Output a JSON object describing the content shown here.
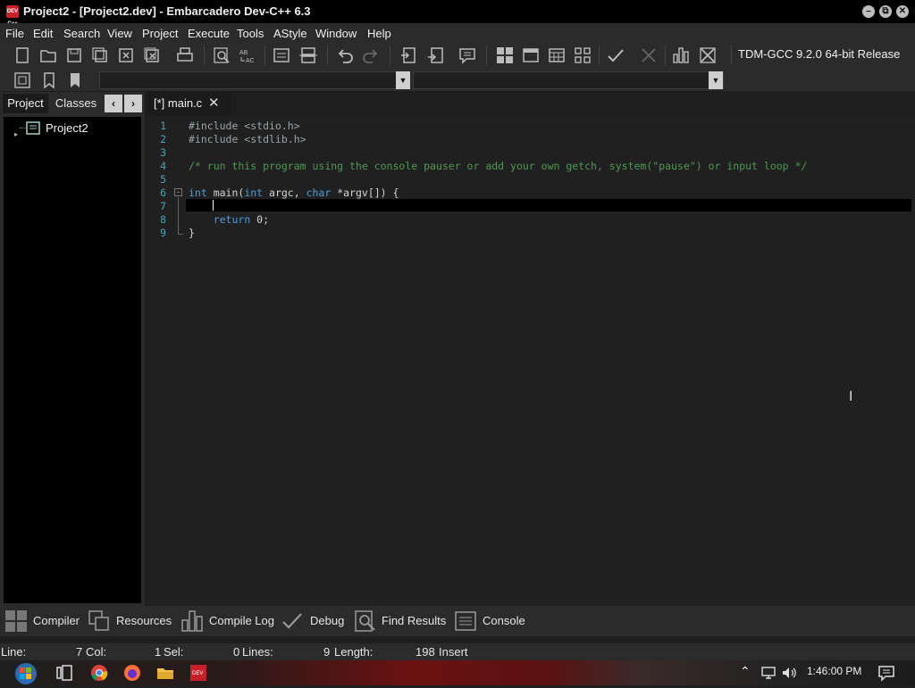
{
  "window": {
    "app_icon_text": "DEV C++",
    "title": "Project2 - [Project2.dev] - Embarcadero Dev-C++ 6.3",
    "minimize": "–",
    "restore": "⧉",
    "close": "✕"
  },
  "menu": [
    "File",
    "Edit",
    "Search",
    "View",
    "Project",
    "Execute",
    "Tools",
    "AStyle",
    "Window",
    "Help"
  ],
  "toolbar": {
    "compiler": "TDM-GCC 9.2.0 64-bit Release",
    "icons": [
      "new-file-icon",
      "open-icon",
      "save-icon",
      "save-all-icon",
      "close-icon",
      "close-all-icon",
      "print-icon",
      "find-icon",
      "replace-icon",
      "goto-icon",
      "indent-icon",
      "undo-icon",
      "redo-icon",
      "unindent-icon",
      "import-icon",
      "comment-icon",
      "grid-icon",
      "window-icon",
      "calendar-icon",
      "apps-icon",
      "check-icon",
      "cross-icon",
      "chart-icon",
      "cross-box-icon"
    ]
  },
  "left_panel": {
    "tabs": [
      "Project",
      "Classes"
    ],
    "prev": "‹",
    "next": "›",
    "tree_root": "Project2"
  },
  "editor": {
    "tab_label": "[*] main.c",
    "tab_close": "✕",
    "lines": [
      {
        "n": "1",
        "text": "#include <stdio.h>",
        "kind": "pp"
      },
      {
        "n": "2",
        "text": "#include <stdlib.h>",
        "kind": "pp"
      },
      {
        "n": "3",
        "text": "",
        "kind": "plain"
      },
      {
        "n": "4",
        "text": "/* run this program using the console pauser or add your own getch, system(\"pause\") or input loop */",
        "kind": "cm"
      },
      {
        "n": "5",
        "text": "",
        "kind": "plain"
      },
      {
        "n": "6",
        "text": "int main(int argc, char *argv[]) {",
        "kind": "main"
      },
      {
        "n": "7",
        "text": "",
        "kind": "plain"
      },
      {
        "n": "8",
        "text": "    return 0;",
        "kind": "ret"
      },
      {
        "n": "9",
        "text": "}",
        "kind": "plain"
      }
    ]
  },
  "bottom_tabs": [
    "Compiler",
    "Resources",
    "Compile Log",
    "Debug",
    "Find Results",
    "Console"
  ],
  "status": {
    "line_label": "Line:",
    "line_value": "7",
    "col_label": "Col:",
    "col_value": "1",
    "sel_label": "Sel:",
    "sel_value": "0",
    "lines_label": "Lines:",
    "lines_value": "9",
    "length_label": "Length:",
    "length_value": "198",
    "mode": "Insert"
  },
  "taskbar": {
    "time": "1:46:00 PM",
    "tray_up": "⌃"
  }
}
